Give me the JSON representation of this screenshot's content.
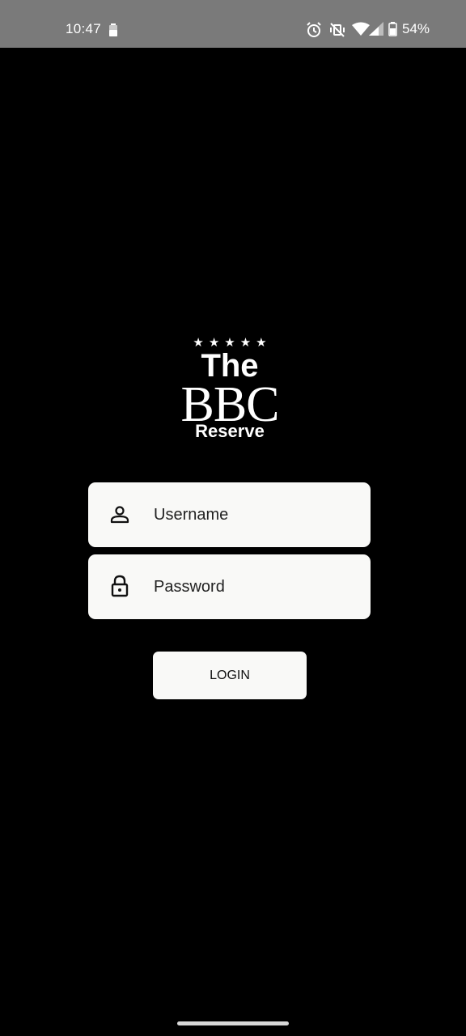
{
  "status_bar": {
    "time": "10:47",
    "battery_percent": "54%",
    "icons": [
      "battery-saver-icon",
      "alarm-icon",
      "vibrate-off-icon",
      "wifi-icon",
      "signal-icon",
      "battery-icon"
    ]
  },
  "logo": {
    "stars": "★★★★★",
    "line1": "The",
    "line2": "BBC",
    "line3": "Reserve"
  },
  "login_form": {
    "username_placeholder": "Username",
    "password_placeholder": "Password",
    "login_label": "LOGIN"
  },
  "colors": {
    "background": "#000000",
    "status_bar": "#7a7a7a",
    "field_background": "#f9f9f7"
  }
}
